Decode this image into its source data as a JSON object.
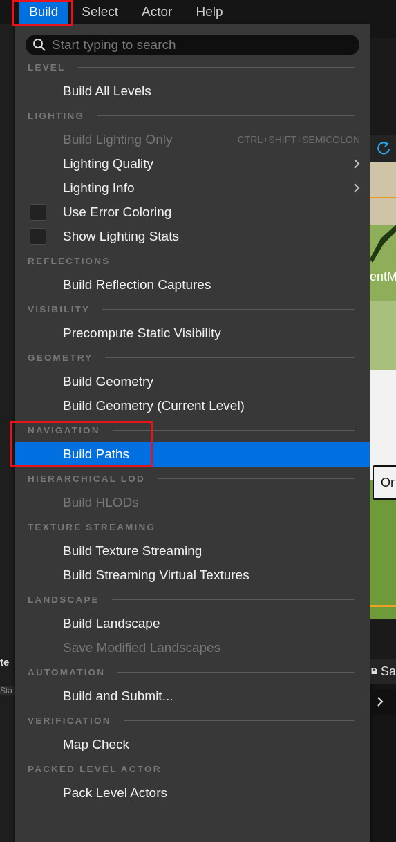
{
  "menubar": [
    {
      "label": "Build",
      "selected": true,
      "annotated": true
    },
    {
      "label": "Select",
      "selected": false,
      "annotated": false
    },
    {
      "label": "Actor",
      "selected": false,
      "annotated": false
    },
    {
      "label": "Help",
      "selected": false,
      "annotated": false
    }
  ],
  "search": {
    "placeholder": "Start typing to search"
  },
  "sections": [
    {
      "title": "LEVEL",
      "annotated": false,
      "items": [
        {
          "kind": "command",
          "label": "Build All Levels",
          "disabled": false,
          "selected": false
        }
      ]
    },
    {
      "title": "LIGHTING",
      "annotated": false,
      "items": [
        {
          "kind": "command",
          "label": "Build Lighting Only",
          "shortcut": "CTRL+SHIFT+SEMICOLON",
          "disabled": true,
          "selected": false
        },
        {
          "kind": "submenu",
          "label": "Lighting Quality",
          "disabled": false,
          "selected": false
        },
        {
          "kind": "submenu",
          "label": "Lighting Info",
          "disabled": false,
          "selected": false
        },
        {
          "kind": "checkbox",
          "label": "Use Error Coloring",
          "checked": false,
          "disabled": false,
          "selected": false
        },
        {
          "kind": "checkbox",
          "label": "Show Lighting Stats",
          "checked": false,
          "disabled": false,
          "selected": false
        }
      ]
    },
    {
      "title": "REFLECTIONS",
      "annotated": false,
      "items": [
        {
          "kind": "command",
          "label": "Build Reflection Captures",
          "disabled": false,
          "selected": false
        }
      ]
    },
    {
      "title": "VISIBILITY",
      "annotated": false,
      "items": [
        {
          "kind": "command",
          "label": "Precompute Static Visibility",
          "disabled": false,
          "selected": false
        }
      ]
    },
    {
      "title": "GEOMETRY",
      "annotated": false,
      "items": [
        {
          "kind": "command",
          "label": "Build Geometry",
          "disabled": false,
          "selected": false
        },
        {
          "kind": "command",
          "label": "Build Geometry (Current Level)",
          "disabled": false,
          "selected": false
        }
      ]
    },
    {
      "title": "NAVIGATION",
      "annotated": true,
      "items": [
        {
          "kind": "command",
          "label": "Build Paths",
          "disabled": false,
          "selected": true
        }
      ]
    },
    {
      "title": "HIERARCHICAL LOD",
      "annotated": false,
      "items": [
        {
          "kind": "command",
          "label": "Build HLODs",
          "disabled": true,
          "selected": false
        }
      ]
    },
    {
      "title": "TEXTURE STREAMING",
      "annotated": false,
      "items": [
        {
          "kind": "command",
          "label": "Build Texture Streaming",
          "disabled": false,
          "selected": false
        },
        {
          "kind": "command",
          "label": "Build Streaming Virtual Textures",
          "disabled": false,
          "selected": false
        }
      ]
    },
    {
      "title": "LANDSCAPE",
      "annotated": false,
      "items": [
        {
          "kind": "command",
          "label": "Build Landscape",
          "disabled": false,
          "selected": false
        },
        {
          "kind": "command",
          "label": "Save Modified Landscapes",
          "disabled": true,
          "selected": false
        }
      ]
    },
    {
      "title": "AUTOMATION",
      "annotated": false,
      "items": [
        {
          "kind": "command",
          "label": "Build and Submit...",
          "disabled": false,
          "selected": false
        }
      ]
    },
    {
      "title": "VERIFICATION",
      "annotated": false,
      "items": [
        {
          "kind": "command",
          "label": "Map Check",
          "disabled": false,
          "selected": false
        }
      ]
    },
    {
      "title": "PACKED LEVEL ACTOR",
      "annotated": false,
      "items": [
        {
          "kind": "command",
          "label": "Pack Level Actors",
          "disabled": false,
          "selected": false
        }
      ]
    }
  ],
  "background": {
    "panel_title": "te",
    "panel_field": "Sta",
    "viewport_label": "entM",
    "viewport_button": "Or",
    "save_label": "Sa"
  }
}
